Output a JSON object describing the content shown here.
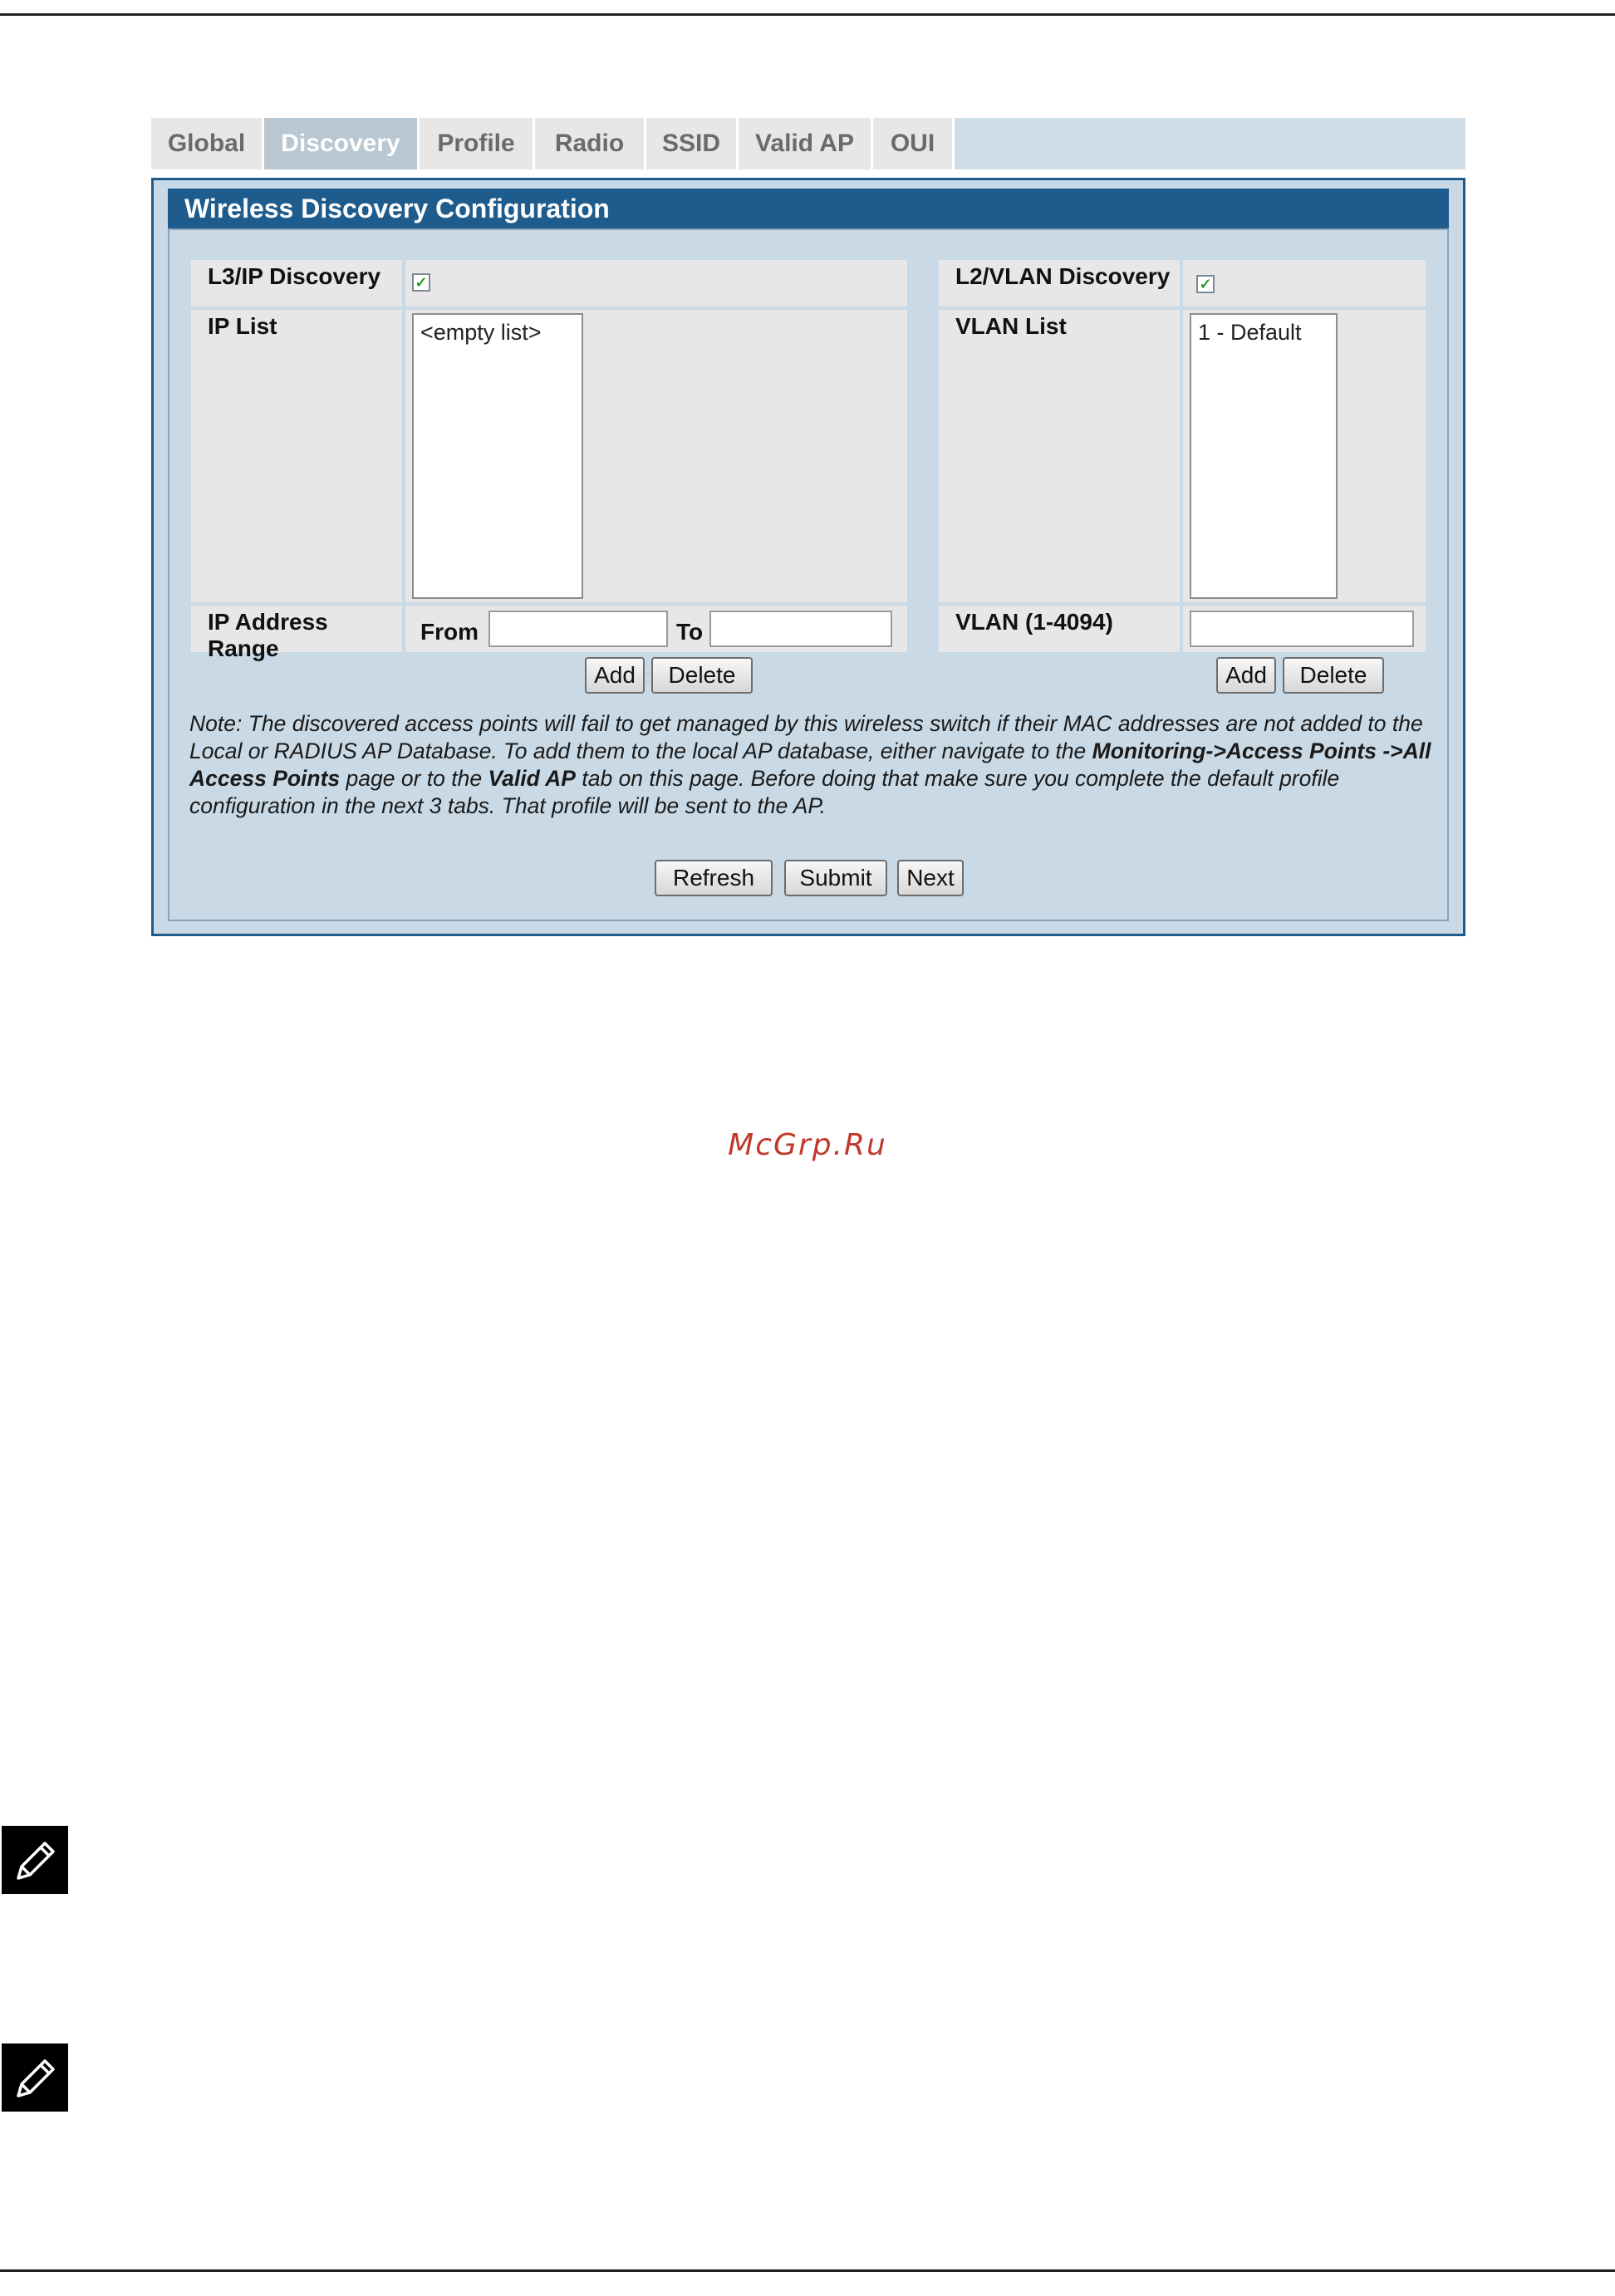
{
  "tabs": [
    {
      "label": "Global",
      "active": false
    },
    {
      "label": "Discovery",
      "active": true
    },
    {
      "label": "Profile",
      "active": false
    },
    {
      "label": "Radio",
      "active": false
    },
    {
      "label": "SSID",
      "active": false
    },
    {
      "label": "Valid AP",
      "active": false
    },
    {
      "label": "OUI",
      "active": false
    }
  ],
  "panel": {
    "title": "Wireless Discovery Configuration",
    "l3": {
      "discovery_label": "L3/IP Discovery",
      "discovery_checked": true,
      "list_label": "IP List",
      "list_items": [
        "<empty list>"
      ],
      "range_label": "IP Address Range",
      "from_label": "From",
      "to_label": "To",
      "from_value": "",
      "to_value": "",
      "add_label": "Add",
      "delete_label": "Delete"
    },
    "l2": {
      "discovery_label": "L2/VLAN Discovery",
      "discovery_checked": true,
      "list_label": "VLAN List",
      "list_items": [
        "1 - Default"
      ],
      "vlan_label": "VLAN (1-4094)",
      "vlan_value": "",
      "add_label": "Add",
      "delete_label": "Delete"
    },
    "note": {
      "part1": "Note: The discovered access points will fail to get managed by this wireless switch if their MAC addresses are not added to the Local or RADIUS AP Database. To add them to the local AP database, either navigate to the ",
      "bold1": "Monitoring->Access Points ->All Access Points",
      "part2": " page or to the ",
      "bold2": "Valid AP",
      "part3": " tab on this page. Before doing that make sure you complete the default profile configuration in the next 3 tabs. That profile will be sent to the AP."
    },
    "buttons": {
      "refresh": "Refresh",
      "submit": "Submit",
      "next": "Next"
    }
  },
  "watermark": "McGrp.Ru",
  "icons": {
    "checkbox": "check-icon",
    "note": "pencil-icon"
  },
  "colors": {
    "header_blue": "#1f5c8e",
    "panel_bg": "#c9d9e5",
    "watermark": "#c0392b",
    "check_green": "#2a9a2a"
  }
}
